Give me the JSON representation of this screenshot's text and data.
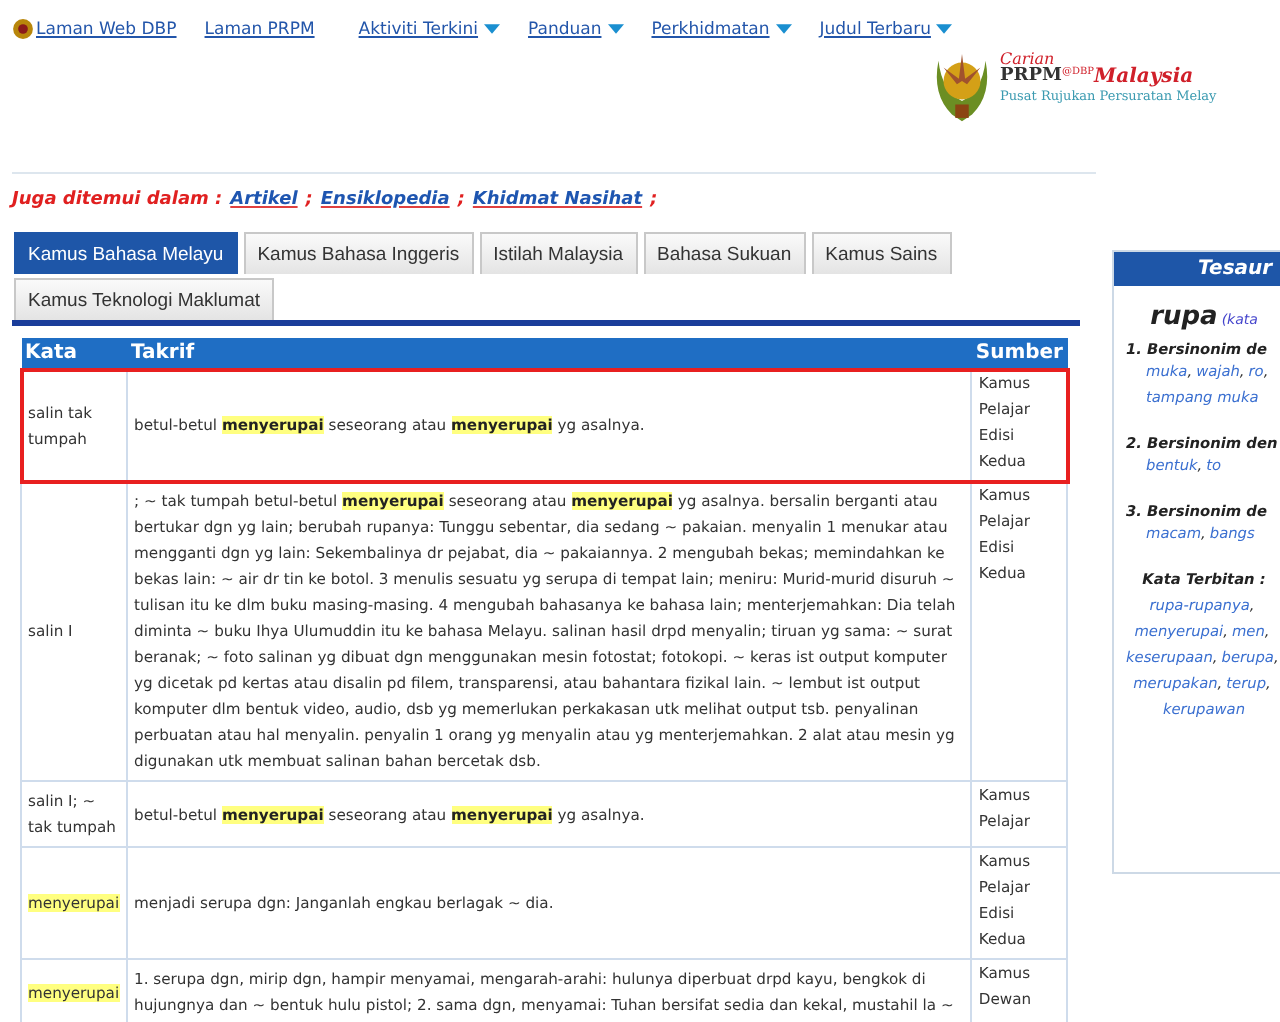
{
  "nav": [
    {
      "label": "Laman Web DBP",
      "dropdown": false
    },
    {
      "label": "Laman PRPM",
      "dropdown": false
    },
    {
      "label": "Aktiviti Terkini",
      "dropdown": true
    },
    {
      "label": "Panduan",
      "dropdown": true
    },
    {
      "label": "Perkhidmatan",
      "dropdown": true
    },
    {
      "label": "Judul Terbaru",
      "dropdown": true
    }
  ],
  "logo": {
    "carian": "Carian",
    "prpm": "PRPM",
    "at": "@DBP",
    "malaysia": "Malaysia",
    "tagline": "Pusat Rujukan Persuratan Melay"
  },
  "also_found": {
    "label": "Juga ditemui dalam :",
    "links": [
      "Artikel",
      "Ensiklopedia",
      "Khidmat Nasihat"
    ],
    "separator": ";"
  },
  "tabs": [
    {
      "label": "Kamus Bahasa Melayu",
      "selected": true
    },
    {
      "label": "Kamus Bahasa Inggeris",
      "selected": false
    },
    {
      "label": "Istilah Malaysia",
      "selected": false
    },
    {
      "label": "Bahasa Sukuan",
      "selected": false
    },
    {
      "label": "Kamus Sains",
      "selected": false
    },
    {
      "label": "Kamus Teknologi Maklumat",
      "selected": false
    }
  ],
  "table": {
    "columns": [
      "Kata",
      "Takrif",
      "Sumber"
    ],
    "rows": [
      {
        "kata": "salin tak tumpah",
        "kata_highlighted": false,
        "outlined": true,
        "takrif": "betul-betul **menyerupai** seseorang atau **menyerupai** yg asalnya.",
        "sumber": "Kamus Pelajar Edisi Kedua"
      },
      {
        "kata": "salin I",
        "kata_highlighted": false,
        "outlined": false,
        "takrif": "; ~ tak tumpah betul-betul **menyerupai** seseorang atau **menyerupai** yg asalnya. bersalin berganti atau bertukar dgn yg lain; berubah rupanya: Tunggu sebentar, dia sedang ~ pakaian. menyalin 1 menukar atau mengganti dgn yg lain: Sekembalinya dr pejabat, dia ~ pakaiannya. 2 mengubah bekas; memindahkan ke bekas lain: ~ air dr tin ke botol. 3 menulis sesuatu yg serupa di tempat lain; meniru: Murid-murid disuruh ~ tulisan itu ke dlm buku masing-masing. 4 mengubah bahasanya ke bahasa lain; menterjemahkan: Dia telah diminta ~ buku Ihya Ulumuddin itu ke bahasa Melayu. salinan hasil drpd menyalin; tiruan yg sama: ~ surat beranak; ~ foto salinan yg dibuat dgn menggunakan mesin fotostat; fotokopi. ~ keras ist output komputer yg dicetak pd kertas atau disalin pd filem, transparensi, atau bahantara fizikal lain. ~ lembut ist output komputer dlm bentuk video, audio, dsb yg memerlukan perkakasan utk melihat output tsb. penyalinan perbuatan atau hal menyalin. penyalin 1 orang yg menyalin atau yg menterjemahkan. 2 alat atau mesin yg digunakan utk membuat salinan bahan bercetak dsb.",
        "sumber": "Kamus Pelajar Edisi Kedua"
      },
      {
        "kata": "salin I; ~ tak tumpah",
        "kata_highlighted": false,
        "outlined": false,
        "takrif": "betul-betul **menyerupai** seseorang atau **menyerupai** yg asalnya.",
        "sumber": "Kamus Pelajar"
      },
      {
        "kata": "menyerupai",
        "kata_highlighted": true,
        "outlined": false,
        "takrif": "menjadi serupa dgn: Janganlah engkau berlagak ~ dia.",
        "sumber": "Kamus Pelajar Edisi Kedua"
      },
      {
        "kata": "menyerupai",
        "kata_highlighted": true,
        "outlined": false,
        "takrif": "1. serupa dgn, mirip dgn, hampir menyamai, mengarah-arahi: hulunya diperbuat drpd kayu, bengkok di hujungnya dan ~ bentuk hulu pistol; 2. sama dgn, menyamai: Tuhan bersifat sedia dan kekal, mustahil la ~",
        "sumber": "Kamus Dewan"
      }
    ]
  },
  "tesaurus": {
    "title": "Tesaur",
    "separator": ",",
    "word": "rupa",
    "word_note": "(kata",
    "groups": [
      {
        "heading": "1. Bersinonim de",
        "lines": [
          [
            "muka",
            "wajah",
            "ro"
          ],
          [
            "tampang muka"
          ]
        ]
      },
      {
        "heading": "2. Bersinonim den",
        "lines": [
          [
            "bentuk",
            "to"
          ]
        ]
      },
      {
        "heading": "3. Bersinonim de",
        "lines": [
          [
            "macam",
            "bangs"
          ]
        ]
      }
    ],
    "derived_label": "Kata Terbitan :",
    "derived_lines": [
      [
        "rupa-rupanya"
      ],
      [
        "menyerupai",
        "men"
      ],
      [
        "keserupaan",
        "berupa"
      ],
      [
        "merupakan",
        "terup"
      ],
      [
        "kerupawan"
      ]
    ]
  }
}
